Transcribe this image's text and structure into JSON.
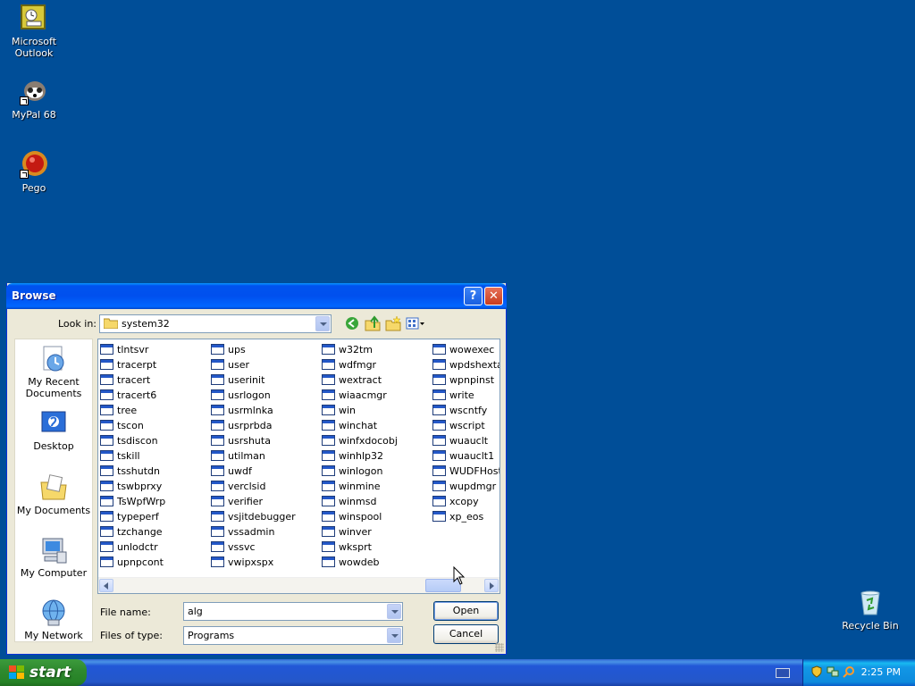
{
  "desktop": {
    "icons": [
      {
        "label": "Microsoft Outlook"
      },
      {
        "label": "MyPal 68"
      },
      {
        "label": "Pego"
      },
      {
        "label": "Recycle Bin"
      }
    ]
  },
  "taskbar": {
    "start_label": "start",
    "clock": "2:25 PM"
  },
  "dialog": {
    "title": "Browse",
    "look_in_label": "Look in:",
    "look_in_value": "system32",
    "places": [
      "My Recent Documents",
      "Desktop",
      "My Documents",
      "My Computer",
      "My Network"
    ],
    "file_columns": [
      [
        "tlntsvr",
        "tracerpt",
        "tracert",
        "tracert6",
        "tree",
        "tscon",
        "tsdiscon",
        "tskill",
        "tsshutdn",
        "tswbprxy",
        "TsWpfWrp",
        "typeperf",
        "tzchange",
        "unlodctr",
        "upnpcont"
      ],
      [
        "ups",
        "user",
        "userinit",
        "usrlogon",
        "usrmlnka",
        "usrprbda",
        "usrshuta",
        "utilman",
        "uwdf",
        "verclsid",
        "verifier",
        "vsjitdebugger",
        "vssadmin",
        "vssvc",
        "vwipxspx"
      ],
      [
        "w32tm",
        "wdfmgr",
        "wextract",
        "wiaacmgr",
        "win",
        "winchat",
        "winfxdocobj",
        "winhlp32",
        "winlogon",
        "winmine",
        "winmsd",
        "winspool",
        "winver",
        "wksprt",
        "wowdeb"
      ],
      [
        "wowexec",
        "wpdshextau",
        "wpnpinst",
        "write",
        "wscntfy",
        "wscript",
        "wuauclt",
        "wuauclt1",
        "WUDFHost",
        "wupdmgr",
        "xcopy",
        "xp_eos"
      ]
    ],
    "file_name_label": "File name:",
    "file_name_value": "alg",
    "files_of_type_label": "Files of type:",
    "files_of_type_value": "Programs",
    "open_label": "Open",
    "cancel_label": "Cancel"
  },
  "colors": {
    "desktop_bg": "#004e98",
    "titlebar": "#0053ee",
    "dialog_bg": "#ece9d8"
  }
}
